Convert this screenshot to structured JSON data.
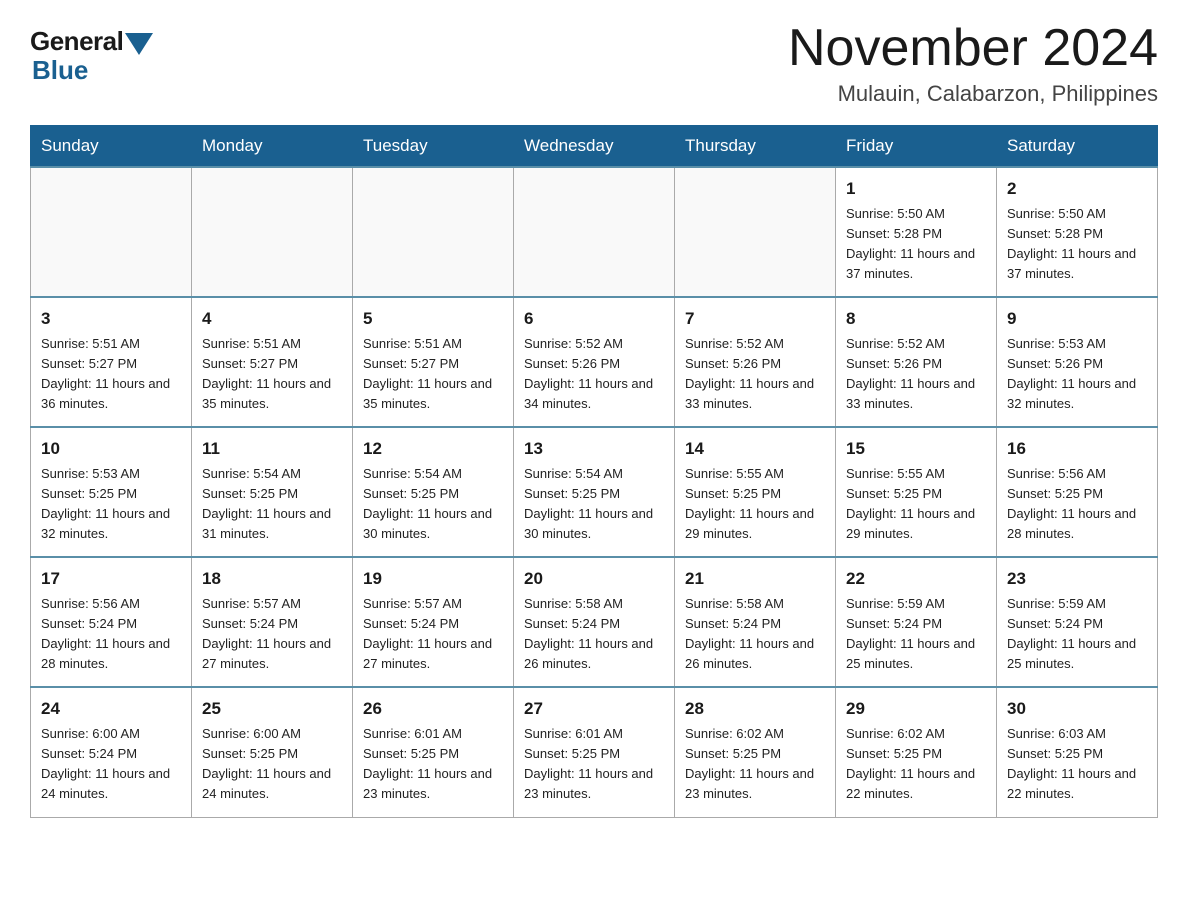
{
  "logo": {
    "general": "General",
    "blue": "Blue"
  },
  "title": {
    "month_year": "November 2024",
    "location": "Mulauin, Calabarzon, Philippines"
  },
  "days_of_week": [
    "Sunday",
    "Monday",
    "Tuesday",
    "Wednesday",
    "Thursday",
    "Friday",
    "Saturday"
  ],
  "weeks": [
    [
      {
        "day": "",
        "info": ""
      },
      {
        "day": "",
        "info": ""
      },
      {
        "day": "",
        "info": ""
      },
      {
        "day": "",
        "info": ""
      },
      {
        "day": "",
        "info": ""
      },
      {
        "day": "1",
        "info": "Sunrise: 5:50 AM\nSunset: 5:28 PM\nDaylight: 11 hours and 37 minutes."
      },
      {
        "day": "2",
        "info": "Sunrise: 5:50 AM\nSunset: 5:28 PM\nDaylight: 11 hours and 37 minutes."
      }
    ],
    [
      {
        "day": "3",
        "info": "Sunrise: 5:51 AM\nSunset: 5:27 PM\nDaylight: 11 hours and 36 minutes."
      },
      {
        "day": "4",
        "info": "Sunrise: 5:51 AM\nSunset: 5:27 PM\nDaylight: 11 hours and 35 minutes."
      },
      {
        "day": "5",
        "info": "Sunrise: 5:51 AM\nSunset: 5:27 PM\nDaylight: 11 hours and 35 minutes."
      },
      {
        "day": "6",
        "info": "Sunrise: 5:52 AM\nSunset: 5:26 PM\nDaylight: 11 hours and 34 minutes."
      },
      {
        "day": "7",
        "info": "Sunrise: 5:52 AM\nSunset: 5:26 PM\nDaylight: 11 hours and 33 minutes."
      },
      {
        "day": "8",
        "info": "Sunrise: 5:52 AM\nSunset: 5:26 PM\nDaylight: 11 hours and 33 minutes."
      },
      {
        "day": "9",
        "info": "Sunrise: 5:53 AM\nSunset: 5:26 PM\nDaylight: 11 hours and 32 minutes."
      }
    ],
    [
      {
        "day": "10",
        "info": "Sunrise: 5:53 AM\nSunset: 5:25 PM\nDaylight: 11 hours and 32 minutes."
      },
      {
        "day": "11",
        "info": "Sunrise: 5:54 AM\nSunset: 5:25 PM\nDaylight: 11 hours and 31 minutes."
      },
      {
        "day": "12",
        "info": "Sunrise: 5:54 AM\nSunset: 5:25 PM\nDaylight: 11 hours and 30 minutes."
      },
      {
        "day": "13",
        "info": "Sunrise: 5:54 AM\nSunset: 5:25 PM\nDaylight: 11 hours and 30 minutes."
      },
      {
        "day": "14",
        "info": "Sunrise: 5:55 AM\nSunset: 5:25 PM\nDaylight: 11 hours and 29 minutes."
      },
      {
        "day": "15",
        "info": "Sunrise: 5:55 AM\nSunset: 5:25 PM\nDaylight: 11 hours and 29 minutes."
      },
      {
        "day": "16",
        "info": "Sunrise: 5:56 AM\nSunset: 5:25 PM\nDaylight: 11 hours and 28 minutes."
      }
    ],
    [
      {
        "day": "17",
        "info": "Sunrise: 5:56 AM\nSunset: 5:24 PM\nDaylight: 11 hours and 28 minutes."
      },
      {
        "day": "18",
        "info": "Sunrise: 5:57 AM\nSunset: 5:24 PM\nDaylight: 11 hours and 27 minutes."
      },
      {
        "day": "19",
        "info": "Sunrise: 5:57 AM\nSunset: 5:24 PM\nDaylight: 11 hours and 27 minutes."
      },
      {
        "day": "20",
        "info": "Sunrise: 5:58 AM\nSunset: 5:24 PM\nDaylight: 11 hours and 26 minutes."
      },
      {
        "day": "21",
        "info": "Sunrise: 5:58 AM\nSunset: 5:24 PM\nDaylight: 11 hours and 26 minutes."
      },
      {
        "day": "22",
        "info": "Sunrise: 5:59 AM\nSunset: 5:24 PM\nDaylight: 11 hours and 25 minutes."
      },
      {
        "day": "23",
        "info": "Sunrise: 5:59 AM\nSunset: 5:24 PM\nDaylight: 11 hours and 25 minutes."
      }
    ],
    [
      {
        "day": "24",
        "info": "Sunrise: 6:00 AM\nSunset: 5:24 PM\nDaylight: 11 hours and 24 minutes."
      },
      {
        "day": "25",
        "info": "Sunrise: 6:00 AM\nSunset: 5:25 PM\nDaylight: 11 hours and 24 minutes."
      },
      {
        "day": "26",
        "info": "Sunrise: 6:01 AM\nSunset: 5:25 PM\nDaylight: 11 hours and 23 minutes."
      },
      {
        "day": "27",
        "info": "Sunrise: 6:01 AM\nSunset: 5:25 PM\nDaylight: 11 hours and 23 minutes."
      },
      {
        "day": "28",
        "info": "Sunrise: 6:02 AM\nSunset: 5:25 PM\nDaylight: 11 hours and 23 minutes."
      },
      {
        "day": "29",
        "info": "Sunrise: 6:02 AM\nSunset: 5:25 PM\nDaylight: 11 hours and 22 minutes."
      },
      {
        "day": "30",
        "info": "Sunrise: 6:03 AM\nSunset: 5:25 PM\nDaylight: 11 hours and 22 minutes."
      }
    ]
  ]
}
